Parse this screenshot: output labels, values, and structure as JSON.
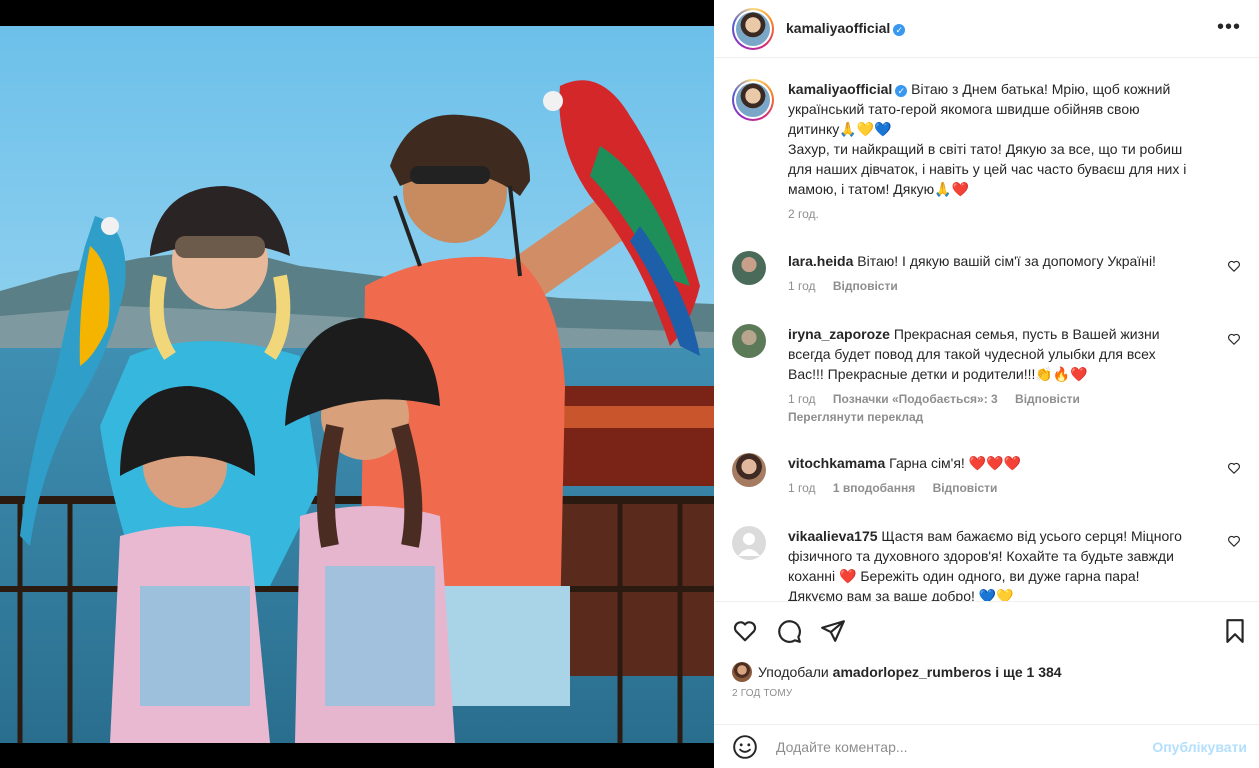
{
  "post": {
    "username": "kamaliyaofficial",
    "more_icon": "more-horizontal-icon",
    "caption": {
      "username": "kamaliyaofficial",
      "lines": [
        "Вітаю з Днем батька! Мрію, щоб кожний",
        "український тато-герой якомога швидше обійняв свою",
        "дитинку🙏💛💙",
        "Захур, ти найкращий в світі тато! Дякую за все, що ти робиш",
        "для наших дівчаток, і навіть у цей час часто буваєш для них і",
        "мамою, і татом! Дякую🙏❤️"
      ],
      "time": "2 год."
    }
  },
  "comments": [
    {
      "username": "lara.heida",
      "text": "Вітаю! І дякую вашій сім'ї за допомогу Україні!",
      "time": "1 год",
      "reply": "Відповісти"
    },
    {
      "username": "iryna_zaporoze",
      "lines": [
        "Прекрасная семья, пусть в Вашей жизни",
        "всегда будет повод для такой чудесной улыбки для всех",
        "Вас!!! Прекрасные детки и родители!!!👏🔥❤️"
      ],
      "time": "1 год",
      "likes": "Позначки «Подобається»: 3",
      "reply": "Відповісти",
      "translate": "Переглянути переклад"
    },
    {
      "username": "vitochkamama",
      "text": "Гарна сім'я! ❤️❤️❤️",
      "time": "1 год",
      "likes": "1 вподобання",
      "reply": "Відповісти"
    },
    {
      "username": "vikaalieva175",
      "lines": [
        "Щастя вам бажаємо від усього серця! Міцного",
        "фізичного та духовного здоров'я! Кохайте та будьте завжди",
        "коханні ❤️ Бережіть один одного, ви дуже гарна пара!",
        "Дякуємо вам за ваше добро! 💙💛"
      ]
    }
  ],
  "actions": {
    "like_icon": "heart-icon",
    "comment_icon": "comment-icon",
    "share_icon": "send-icon",
    "save_icon": "bookmark-icon"
  },
  "likes": {
    "prefix": "Уподобали",
    "user": "amadorlopez_rumberos",
    "suffix": "і ще 1 384"
  },
  "posted_ago": "2 ГОД ТОМУ",
  "add_comment": {
    "emoji_icon": "emoji-icon",
    "placeholder": "Додайте коментар...",
    "publish": "Опублікувати"
  },
  "colors": {
    "link_blue": "#0095f6",
    "publish_disabled": "#b2dffc",
    "secondary_text": "#8e8e8e",
    "verified": "#3897f0"
  }
}
